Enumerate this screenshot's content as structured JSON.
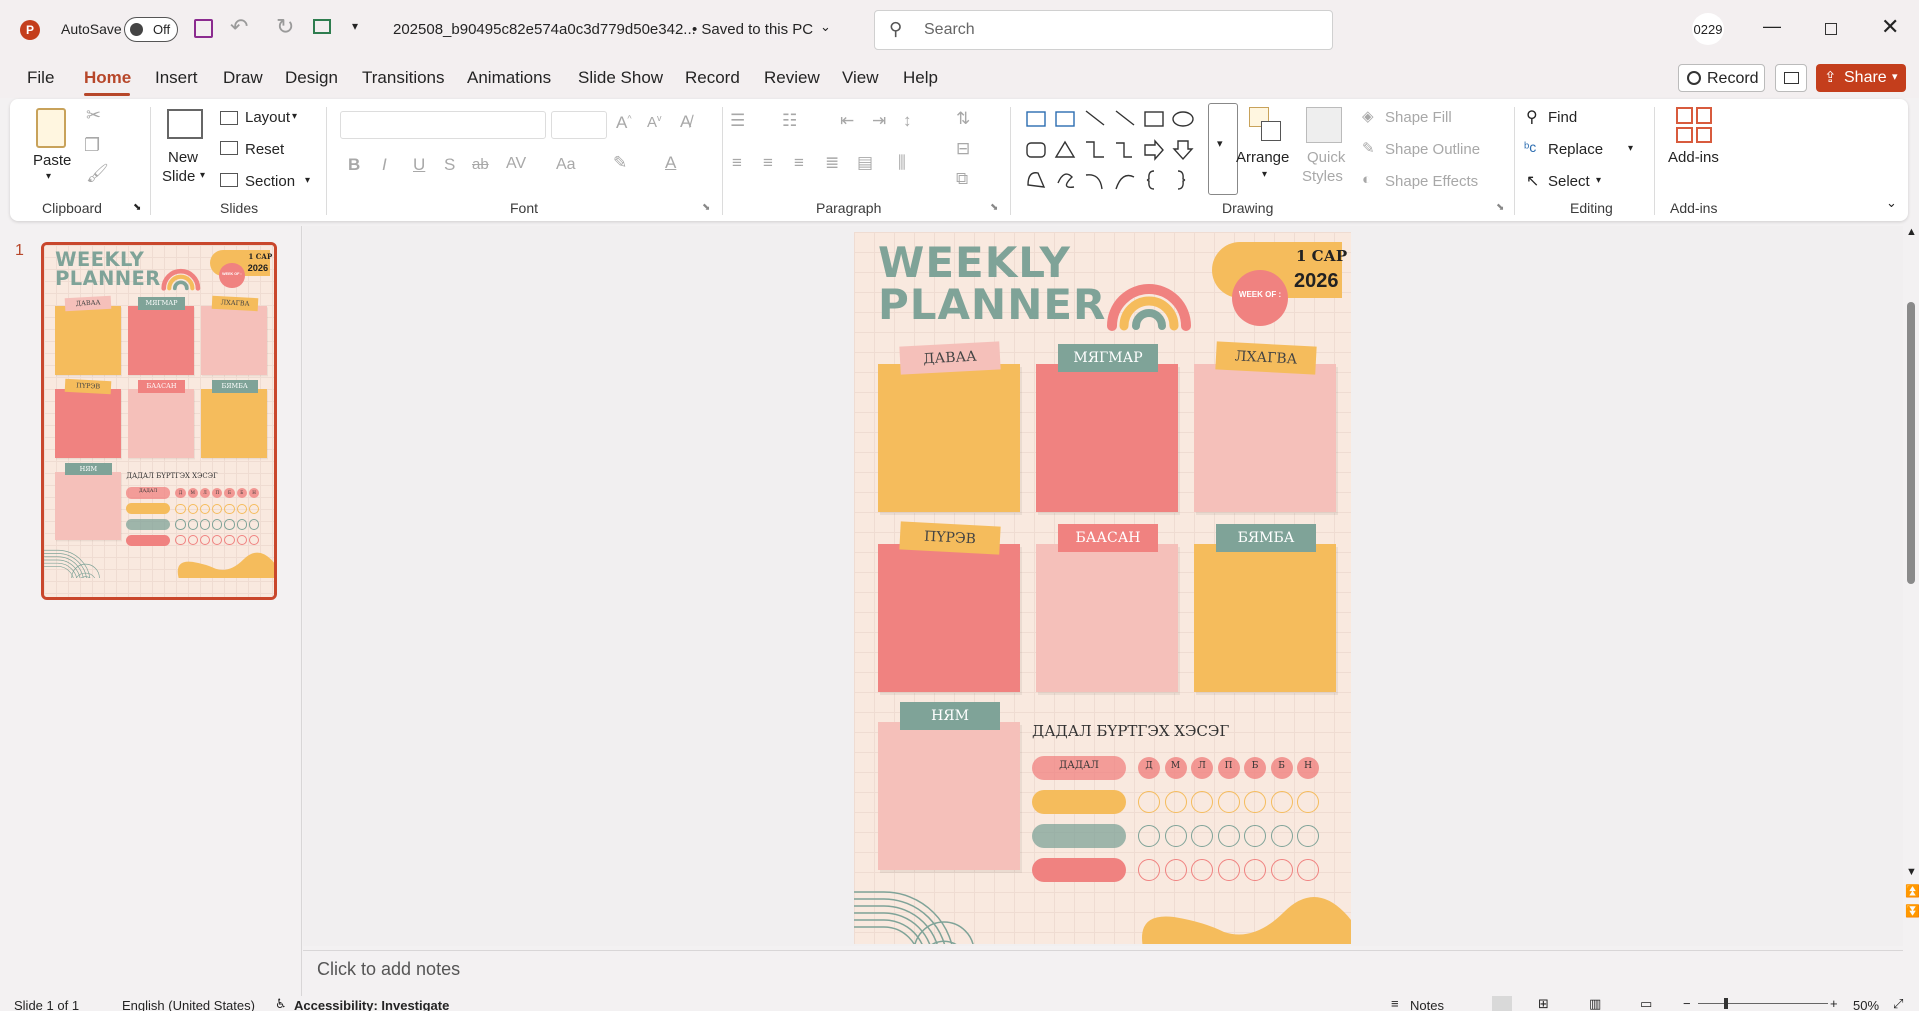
{
  "titlebar": {
    "autosave_label": "AutoSave",
    "autosave_state": "Off",
    "filename": "202508_b90495c82e574a0c3d779d50e342...",
    "save_status": "• Saved to this PC",
    "search_placeholder": "Search",
    "user_badge": "0229"
  },
  "tabs": [
    "File",
    "Home",
    "Insert",
    "Draw",
    "Design",
    "Transitions",
    "Animations",
    "Slide Show",
    "Record",
    "Review",
    "View",
    "Help"
  ],
  "right_buttons": {
    "record": "Record",
    "share": "Share"
  },
  "ribbon": {
    "clipboard": {
      "paste": "Paste",
      "label": "Clipboard"
    },
    "slides": {
      "new_slide": "New",
      "new_slide2": "Slide",
      "layout": "Layout",
      "reset": "Reset",
      "section": "Section",
      "label": "Slides"
    },
    "font": {
      "label": "Font",
      "bold": "B",
      "italic": "I",
      "underline": "U",
      "strike": "S",
      "abc": "ab",
      "spacing": "AV",
      "case": "Aa"
    },
    "paragraph": {
      "label": "Paragraph"
    },
    "drawing": {
      "arrange": "Arrange",
      "quick_styles": "Quick",
      "quick_styles2": "Styles",
      "shape_fill": "Shape Fill",
      "shape_outline": "Shape Outline",
      "shape_effects": "Shape Effects",
      "label": "Drawing"
    },
    "editing": {
      "find": "Find",
      "replace": "Replace",
      "select": "Select",
      "label": "Editing"
    },
    "addins": {
      "addins": "Add-ins",
      "label": "Add-ins"
    }
  },
  "thumb": {
    "number": "1"
  },
  "slide": {
    "title1": "WEEKLY",
    "title2": "PLANNER",
    "month": "1 САР",
    "year": "2026",
    "week_of": "WEEK OF :",
    "days": [
      "ДАВАА",
      "МЯГМАР",
      "ЛХАГВА",
      "ПҮРЭВ",
      "БААСАН",
      "БЯМБА",
      "НЯМ"
    ],
    "habit_title": "ДАДАЛ БҮРТГЭХ ХЭСЭГ",
    "habit_label": "ДАДАЛ",
    "weekday_initials": [
      "Д",
      "М",
      "Л",
      "П",
      "Б",
      "Б",
      "Н"
    ]
  },
  "notes_placeholder": "Click to add notes",
  "status": {
    "slide": "Slide 1 of 1",
    "language": "English (United States)",
    "accessibility": "Accessibility: Investigate",
    "notes": "Notes",
    "zoom": "50%"
  },
  "colors": {
    "accent": "#b7472a",
    "share": "#c43e1c",
    "teal": "#7fa398",
    "orange": "#f5bc5c",
    "coral": "#f08280",
    "pink": "#f5c0ba",
    "title_green": "#7fa398",
    "slide_bg": "#f9e9df"
  }
}
